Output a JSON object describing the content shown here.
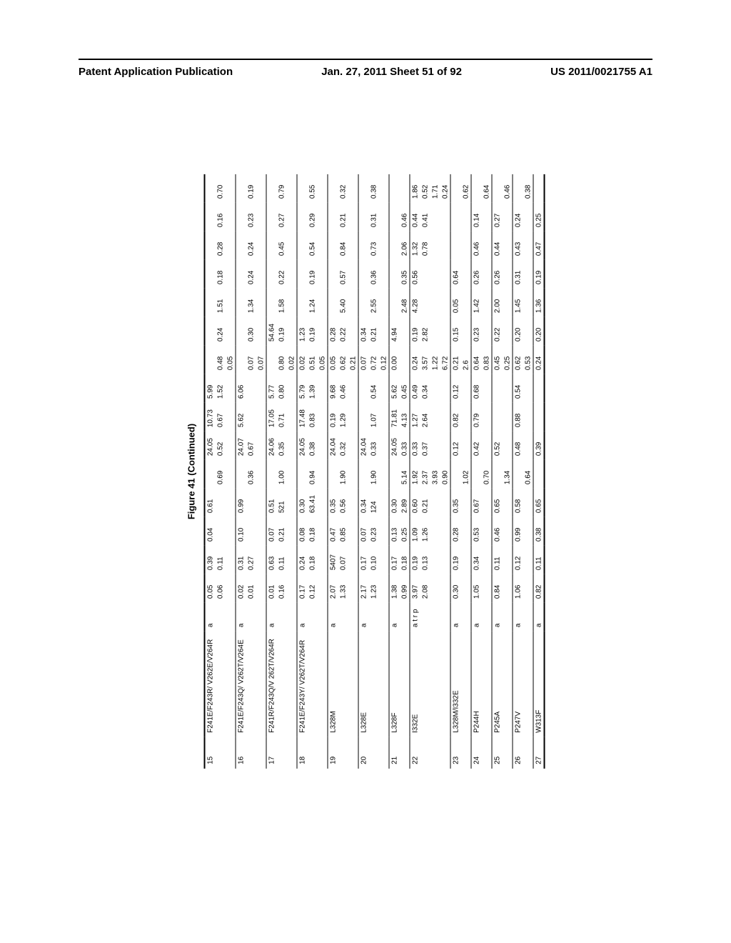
{
  "header": {
    "left": "Patent Application Publication",
    "center": "Jan. 27, 2011  Sheet 51 of 92",
    "right": "US 2011/0021755 A1"
  },
  "caption": "Figure 41 (Continued)",
  "groups": [
    {
      "idx": "15",
      "name": "F241E/F243R/ V262E/V264R",
      "note": "a",
      "rows": [
        [
          "0.05",
          "0.39",
          "0.04",
          "0.61",
          "",
          "24.05",
          "10.73",
          "5.99",
          "",
          "",
          "",
          "",
          "",
          "",
          ""
        ],
        [
          "0.06",
          "0.11",
          "",
          "",
          "0.69",
          "0.52",
          "0.67",
          "1.52",
          "0.48",
          "0.24",
          "1.51",
          "0.18",
          "0.28",
          "0.16",
          "0.70"
        ],
        [
          "",
          "",
          "",
          "",
          "",
          "",
          "",
          "",
          "0.05",
          "",
          "",
          "",
          "",
          "",
          ""
        ]
      ]
    },
    {
      "idx": "16",
      "name": "F241E/F243Q/ V262T/V264E",
      "note": "a",
      "rows": [
        [
          "0.02",
          "0.31",
          "0.10",
          "0.99",
          "",
          "24.07",
          "5.62",
          "6.06",
          "",
          "",
          "",
          "",
          "",
          "",
          ""
        ],
        [
          "0.01",
          "0.27",
          "",
          "",
          "0.36",
          "0.67",
          "",
          "",
          "0.07",
          "0.30",
          "1.34",
          "0.24",
          "0.24",
          "0.23",
          "0.19"
        ],
        [
          "",
          "",
          "",
          "",
          "",
          "",
          "",
          "",
          "0.07",
          "",
          "",
          "",
          "",
          "",
          ""
        ]
      ]
    },
    {
      "idx": "17",
      "name": "F241R/F243Q/V 262T/V264R",
      "note": "a",
      "rows": [
        [
          "0.01",
          "0.63",
          "0.07",
          "0.51",
          "",
          "24.06",
          "17.05",
          "5.77",
          "",
          "54.64",
          "",
          "",
          "",
          "",
          ""
        ],
        [
          "0.16",
          "0.11",
          "0.21",
          "521",
          "1.00",
          "0.35",
          "0.71",
          "0.80",
          "0.80",
          "0.19",
          "1.58",
          "0.22",
          "0.45",
          "0.27",
          "0.79"
        ],
        [
          "",
          "",
          "",
          "",
          "",
          "",
          "",
          "",
          "0.02",
          "",
          "",
          "",
          "",
          "",
          ""
        ]
      ]
    },
    {
      "idx": "18",
      "name": "F241E/F243Y/ V262T/V264R",
      "note": "a",
      "rows": [
        [
          "0.17",
          "0.24",
          "0.08",
          "0.30",
          "",
          "24.05",
          "17.48",
          "5.79",
          "0.02",
          "1.23",
          "",
          "",
          "",
          "",
          ""
        ],
        [
          "0.12",
          "0.18",
          "0.18",
          "63.41",
          "0.94",
          "0.38",
          "0.83",
          "1.39",
          "0.51",
          "0.19",
          "1.24",
          "0.19",
          "0.54",
          "0.29",
          "0.55"
        ],
        [
          "",
          "",
          "",
          "",
          "",
          "",
          "",
          "",
          "0.05",
          "",
          "",
          "",
          "",
          "",
          ""
        ]
      ]
    },
    {
      "idx": "19",
      "name": "L328M",
      "note": "a",
      "rows": [
        [
          "2.07",
          "5407",
          "0.47",
          "0.35",
          "",
          "24.04",
          "0.19",
          "9.68",
          "0.05",
          "0.28",
          "",
          "",
          "",
          "",
          ""
        ],
        [
          "1.33",
          "0.07",
          "0.85",
          "0.56",
          "1.90",
          "0.32",
          "1.29",
          "0.46",
          "0.62",
          "0.22",
          "5.40",
          "0.57",
          "0.84",
          "0.21",
          "0.32"
        ],
        [
          "",
          "",
          "",
          "",
          "",
          "",
          "",
          "",
          "0.21",
          "",
          "",
          "",
          "",
          "",
          ""
        ]
      ]
    },
    {
      "idx": "20",
      "name": "L328E",
      "note": "a",
      "rows": [
        [
          "2.17",
          "0.17",
          "0.07",
          "0.34",
          "",
          "24.04",
          "",
          "",
          "0.07",
          "0.34",
          "",
          "",
          "",
          "",
          ""
        ],
        [
          "1.23",
          "0.10",
          "0.23",
          "124",
          "1.90",
          "0.33",
          "1.07",
          "0.54",
          "0.72",
          "0.21",
          "2.55",
          "0.36",
          "0.73",
          "0.31",
          "0.38"
        ],
        [
          "",
          "",
          "",
          "",
          "",
          "",
          "",
          "",
          "0.12",
          "",
          "",
          "",
          "",
          "",
          ""
        ]
      ]
    },
    {
      "idx": "21",
      "name": "L328F",
      "note": "a",
      "rows": [
        [
          "1.38",
          "0.17",
          "0.13",
          "0.30",
          "",
          "24.05",
          "71.81",
          "5.62",
          "0.00",
          "4.94",
          "",
          "",
          "",
          "",
          ""
        ],
        [
          "0.99",
          "0.18",
          "0.25",
          "2.89",
          "5.14",
          "0.33",
          "4.13",
          "0.45",
          "",
          "",
          "2.48",
          "0.35",
          "2.06",
          "0.46",
          ""
        ]
      ]
    },
    {
      "idx": "22",
      "name": "I332E",
      "note": "a t r p",
      "rows": [
        [
          "3.97",
          "0.19",
          "1.09",
          "0.60",
          "1.92",
          "0.33",
          "1.27",
          "0.49",
          "0.24",
          "0.19",
          "4.28",
          "0.56",
          "1.32",
          "0.44",
          "1.86"
        ],
        [
          "2.08",
          "0.13",
          "1.26",
          "0.21",
          "2.37",
          "0.37",
          "2.64",
          "0.34",
          "3.57",
          "2.82",
          "",
          "",
          "0.78",
          "0.41",
          "0.52"
        ],
        [
          "",
          "",
          "",
          "",
          "3.93",
          "",
          "",
          "",
          "1.22",
          "",
          "",
          "",
          "",
          "",
          "1.71"
        ],
        [
          "",
          "",
          "",
          "",
          "0.90",
          "",
          "",
          "",
          "6.72",
          "",
          "",
          "",
          "",
          "",
          "0.24"
        ]
      ]
    },
    {
      "idx": "23",
      "name": "L328M/I332E",
      "note": "a",
      "rows": [
        [
          "0.30",
          "0.19",
          "0.28",
          "0.35",
          "",
          "0.12",
          "0.82",
          "0.12",
          "0.21",
          "0.15",
          "0.05",
          "0.64",
          "",
          "",
          ""
        ],
        [
          "",
          "",
          "",
          "",
          "1.02",
          "",
          "",
          "",
          "2.6",
          "",
          "",
          "",
          "",
          "",
          "0.62"
        ]
      ]
    },
    {
      "idx": "24",
      "name": "P244H",
      "note": "a",
      "rows": [
        [
          "1.05",
          "0.34",
          "0.53",
          "0.67",
          "",
          "0.42",
          "0.79",
          "0.68",
          "0.64",
          "0.23",
          "1.42",
          "0.26",
          "0.46",
          "0.14",
          ""
        ],
        [
          "",
          "",
          "",
          "",
          "0.70",
          "",
          "",
          "",
          "0.83",
          "",
          "",
          "",
          "",
          "",
          "0.64"
        ]
      ]
    },
    {
      "idx": "25",
      "name": "P245A",
      "note": "a",
      "rows": [
        [
          "0.84",
          "0.11",
          "0.46",
          "0.65",
          "",
          "0.52",
          "",
          "",
          "0.45",
          "0.22",
          "2.00",
          "0.26",
          "0.44",
          "0.27",
          ""
        ],
        [
          "",
          "",
          "",
          "",
          "1.34",
          "",
          "",
          "",
          "0.25",
          "",
          "",
          "",
          "",
          "",
          "0.46"
        ]
      ]
    },
    {
      "idx": "26",
      "name": "P247V",
      "note": "a",
      "rows": [
        [
          "1.06",
          "0.12",
          "0.99",
          "0.58",
          "",
          "0.48",
          "0.88",
          "0.54",
          "0.62",
          "0.20",
          "1.45",
          "0.31",
          "0.43",
          "0.24",
          ""
        ],
        [
          "",
          "",
          "",
          "",
          "0.64",
          "",
          "",
          "",
          "0.53",
          "",
          "",
          "",
          "",
          "",
          "0.38"
        ]
      ]
    },
    {
      "idx": "27",
      "name": "W313F",
      "note": "a",
      "rows": [
        [
          "0.82",
          "0.11",
          "0.38",
          "0.65",
          "",
          "0.39",
          "",
          "",
          "0.24",
          "0.20",
          "1.36",
          "0.19",
          "0.47",
          "0.25",
          ""
        ]
      ]
    }
  ]
}
